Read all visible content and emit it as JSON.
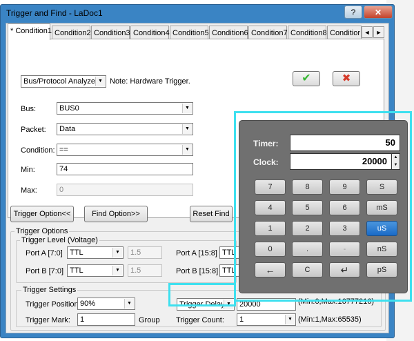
{
  "window": {
    "title": "Trigger and Find - LaDoc1",
    "help_btn": "?",
    "close_btn": "✕"
  },
  "tabs": [
    "* Condition1",
    "Condition2",
    "Condition3",
    "Condition4",
    "Condition5",
    "Condition6",
    "Condition7",
    "Condition8",
    "Conditior"
  ],
  "tab_arrows": {
    "left": "◄",
    "right": "►"
  },
  "condition": {
    "mode": "Bus/Protocol Analyzer",
    "note": "Note: Hardware Trigger.",
    "fields": [
      {
        "label": "Bus:",
        "value": "BUS0"
      },
      {
        "label": "Packet:",
        "value": "Data"
      },
      {
        "label": "Condition:",
        "value": "=="
      },
      {
        "label": "Min:",
        "value": "74"
      },
      {
        "label": "Max:",
        "value": "0"
      }
    ]
  },
  "buttons": {
    "ok_icon": "✔",
    "cancel_icon": "✖",
    "trigger_option": "Trigger Option<<",
    "find_option": "Find Option>>",
    "reset_find": "Reset Find"
  },
  "trigger_options": {
    "title": "Trigger Options",
    "level_title": "Trigger Level (Voltage)",
    "port_a_lo": {
      "label": "Port A [7:0]",
      "value": "TTL",
      "voltage": "1.5"
    },
    "port_b_lo": {
      "label": "Port B [7:0]",
      "value": "TTL",
      "voltage": "1.5"
    },
    "port_a_hi": {
      "label": "Port A [15:8]",
      "value": "TTL"
    },
    "port_b_hi": {
      "label": "Port B [15:8]",
      "value": "TTL"
    }
  },
  "trigger_settings": {
    "title": "Trigger Settings",
    "position_label": "Trigger Position:",
    "position_value": "90%",
    "mark_label": "Trigger Mark:",
    "mark_value": "1",
    "group_label": "Group",
    "delay_mode": "Trigger Delay",
    "delay_value": "20000",
    "delay_range": "(Min:0,Max:16777216)",
    "count_label": "Trigger Count:",
    "count_value": "1",
    "count_range": "(Min:1,Max:65535)"
  },
  "calculator": {
    "timer_label": "Timer:",
    "timer_value": "50",
    "clock_label": "Clock:",
    "clock_value": "20000",
    "spin_up": "▲",
    "spin_down": "▼",
    "keys": [
      [
        "7",
        "8",
        "9",
        "S"
      ],
      [
        "4",
        "5",
        "6",
        "mS"
      ],
      [
        "1",
        "2",
        "3",
        "uS"
      ],
      [
        "0",
        ".",
        "-",
        "nS"
      ],
      [
        "←",
        "C",
        "↵",
        "pS"
      ]
    ],
    "selected_unit": "uS"
  },
  "colors": {
    "highlight": "#3ee0ef",
    "calc_bg": "#707070",
    "selected_key": "#1a6bc7",
    "window_frame": "#3a84c4"
  }
}
